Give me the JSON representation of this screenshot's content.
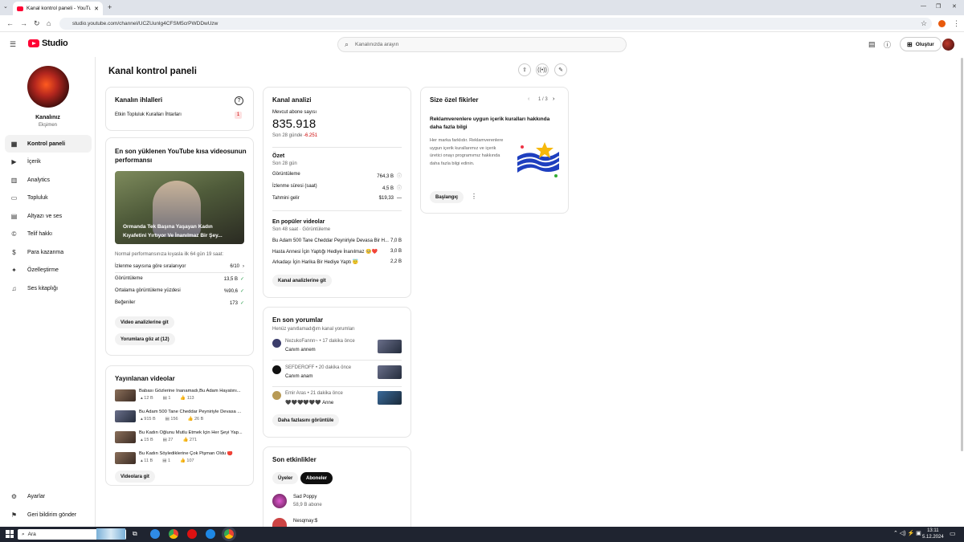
{
  "browser": {
    "tab_title": "Kanal kontrol paneli - YouTube",
    "url": "studio.youtube.com/channel/UCZUunlg4CFSM5crPWDDwUzw"
  },
  "header": {
    "logo": "Studio",
    "search_placeholder": "Kanalınızda arayın",
    "create_label": "Oluştur"
  },
  "sidebar": {
    "channel_title": "Kanalınız",
    "channel_name": "Ekşimen",
    "items": [
      {
        "label": "Kontrol paneli",
        "icon": "dashboard-icon",
        "active": true
      },
      {
        "label": "İçerik",
        "icon": "content-icon"
      },
      {
        "label": "Analytics",
        "icon": "analytics-icon"
      },
      {
        "label": "Topluluk",
        "icon": "community-icon"
      },
      {
        "label": "Altyazı ve ses",
        "icon": "subtitles-icon"
      },
      {
        "label": "Telif hakkı",
        "icon": "copyright-icon"
      },
      {
        "label": "Para kazanma",
        "icon": "monetization-icon"
      },
      {
        "label": "Özelleştirme",
        "icon": "customization-icon"
      },
      {
        "label": "Ses kitaplığı",
        "icon": "audio-library-icon"
      }
    ],
    "footer": [
      {
        "label": "Ayarlar",
        "icon": "gear-icon"
      },
      {
        "label": "Geri bildirim gönder",
        "icon": "feedback-icon"
      }
    ]
  },
  "main": {
    "title": "Kanal kontrol paneli"
  },
  "violations": {
    "title": "Kanalın ihlalleri",
    "row_label": "Etkin Topluluk Kuralları İhtarları",
    "row_value": "1"
  },
  "short_perf": {
    "title": "En son yüklenen YouTube kısa videosunun performansı",
    "thumb_title": "Ormanda Tek Başına Yaşayan Kadın Kıyafetini Yırtıyor Ve İnanılmaz Bir Şey...",
    "note": "Normal performansınıza kıyasla ilk 64 gün 19 saat:",
    "rows": [
      {
        "label": "İzlenme sayısına göre sıralanıyor",
        "value": "6/10",
        "mark": "›"
      },
      {
        "label": "Görüntüleme",
        "value": "13,5 B",
        "mark": "✓"
      },
      {
        "label": "Ortalama görüntüleme yüzdesi",
        "value": "%90,6",
        "mark": "✓"
      },
      {
        "label": "Beğeniler",
        "value": "173",
        "mark": "✓"
      }
    ],
    "btn1": "Video analizlerine git",
    "btn2": "Yorumlara göz at (12)"
  },
  "published": {
    "title": "Yayınlanan videolar",
    "items": [
      {
        "title": "Babası Gözlerine İnanamadı,Bu Adam Hayatını...",
        "views": "12 B",
        "comments": "1",
        "likes": "113"
      },
      {
        "title": "Bu Adam 500 Tane Cheddar Peyniriyle Devasa ...",
        "views": "915 B",
        "comments": "156",
        "likes": "26 B"
      },
      {
        "title": "Bu Kadın Oğlunu Mutlu Etmek İçin Her Şeyi Yap...",
        "views": "15 B",
        "comments": "27",
        "likes": "271"
      },
      {
        "title": "Bu Kadın Söylediklerine Çok Pişman Oldu 🔴",
        "views": "11 B",
        "comments": "1",
        "likes": "107"
      }
    ],
    "btn": "Videolara git"
  },
  "analytics": {
    "title": "Kanal analizi",
    "sub_label": "Mevcut abone sayısı",
    "subs": "835.918",
    "period_label": "Son 28 günde",
    "period_change": "-6.251",
    "summary_title": "Özet",
    "summary_period": "Son 28 gün",
    "rows": [
      {
        "label": "Görüntüleme",
        "value": "764,3 B",
        "mark": "ⓘ"
      },
      {
        "label": "İzlenme süresi (saat)",
        "value": "4,5 B",
        "mark": "ⓘ"
      },
      {
        "label": "Tahmini gelir",
        "value": "$19,33",
        "mark": "—"
      }
    ],
    "top_title": "En popüler videolar",
    "top_period": "Son 48 saat · Görüntüleme",
    "top": [
      {
        "title": "Bu Adam 500 Tane Cheddar Peyniriyle Devasa Bir H...",
        "value": "7,0 B"
      },
      {
        "title": "Hasta Annesi İçin Yaptığı Hediye İnanılmaz 🥺❤️",
        "value": "3,0 B"
      },
      {
        "title": "Arkadaşı İçin Harika Bir Hediye Yaptı 😇",
        "value": "2,2 B"
      }
    ],
    "btn": "Kanal analizlerine git"
  },
  "comments": {
    "title": "En son yorumlar",
    "sub": "Henüz yanıtlamadığım kanal yorumları",
    "items": [
      {
        "author": "NezukoFannn~",
        "time": "17 dakika önce",
        "text": "Canım annem"
      },
      {
        "author": "SEFDEROFF",
        "time": "20 dakika önce",
        "text": "Canım anam"
      },
      {
        "author": "Emir Aras",
        "time": "21 dakika önce",
        "text": "🖤🖤🖤🖤🖤🖤 Anne"
      }
    ],
    "btn": "Daha fazlasını görüntüle"
  },
  "activity": {
    "title": "Son etkinlikler",
    "tab1": "Üyeler",
    "tab2": "Aboneler",
    "items": [
      {
        "name": "Sad Poppy",
        "subs": "58,9 B abone"
      },
      {
        "name": "Nesqmay:$",
        "subs": ""
      }
    ]
  },
  "ideas": {
    "title": "Size özel fikirler",
    "pager": "1 / 3",
    "heading": "Reklamverenlere uygun içerik kuralları hakkında daha fazla bilgi",
    "body": "Her marka farklıdır. Reklamverenlere uygun içerik kurallarımız ve içerik üretici onayı programımız hakkında daha fazla bilgi edinin.",
    "btn": "Başlangıç"
  },
  "taskbar": {
    "search": "Ara",
    "time": "13:11",
    "date": "5.12.2024"
  }
}
